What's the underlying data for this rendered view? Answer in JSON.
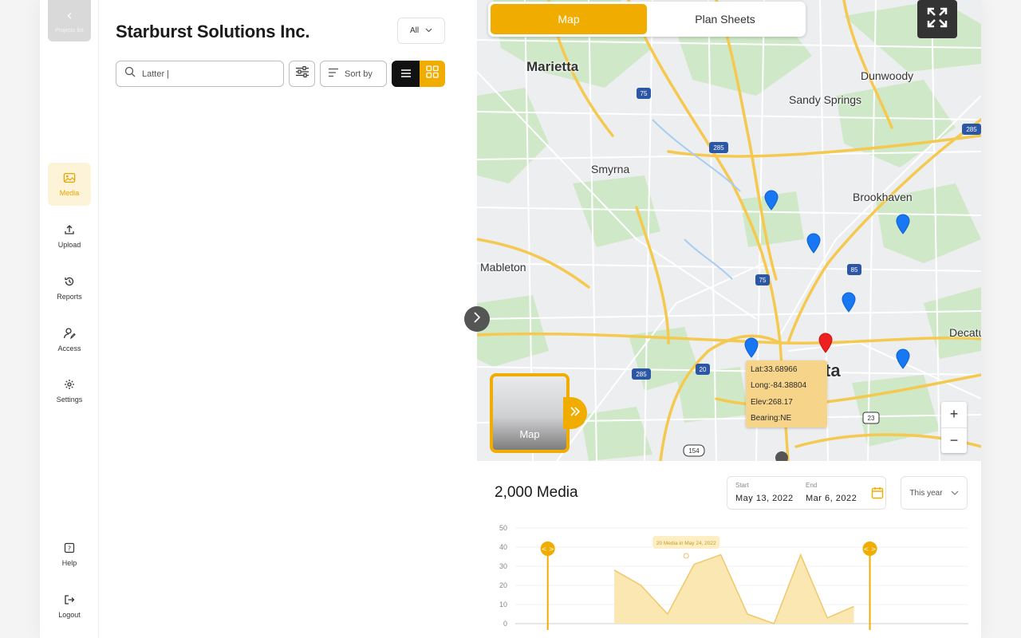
{
  "sidebar": {
    "back_label": "Projects list",
    "items": [
      {
        "label": "Media",
        "icon": "image-icon",
        "active": true
      },
      {
        "label": "Upload",
        "icon": "upload-icon"
      },
      {
        "label": "Reports",
        "icon": "history-icon"
      },
      {
        "label": "Access",
        "icon": "user-edit-icon"
      },
      {
        "label": "Settings",
        "icon": "gear-icon"
      }
    ],
    "bottom_items": [
      {
        "label": "Help",
        "icon": "help-icon"
      },
      {
        "label": "Logout",
        "icon": "logout-icon"
      }
    ]
  },
  "project": {
    "title": "Starburst Solutions Inc.",
    "filter_value": "All"
  },
  "search": {
    "value": "Latter |",
    "sort_label": "Sort by"
  },
  "map": {
    "tabs": [
      {
        "label": "Map",
        "active": true
      },
      {
        "label": "Plan Sheets",
        "active": false
      }
    ],
    "places": {
      "marietta": "Marietta",
      "dunwoody": "Dunwoody",
      "sandy_springs": "Sandy Springs",
      "smyrna": "Smyrna",
      "brookhaven": "Brookhaven",
      "mableton": "Mableton",
      "decatur": "Decatur",
      "atlanta_fragment": "ta"
    },
    "highways": {
      "h75a": "75",
      "h285a": "285",
      "h285b": "285",
      "h75b": "75",
      "h85": "85",
      "h20": "20",
      "h285c": "285",
      "h23": "23",
      "h154": "154"
    },
    "coord": {
      "lat": "Lat:33.68966",
      "long": "Long:-84.38804",
      "elev": "Elev:268.17",
      "bearing": "Bearing:NE"
    },
    "layer_label": "Map",
    "zoom_in": "+",
    "zoom_out": "−",
    "accent": "#f0ad00",
    "pin_color": "#1877f2",
    "selected_pin_color": "#ef2020"
  },
  "summary": {
    "count_label": "2,000 Media",
    "start_caption": "Start",
    "start_date": "May 13, 2022",
    "end_caption": "End",
    "end_date": "Mar 6, 2022",
    "period": "This year"
  },
  "chart_data": {
    "type": "area",
    "y_ticks": [
      "50",
      "40",
      "30",
      "20",
      "10",
      "0"
    ],
    "ylim": [
      0,
      50
    ],
    "x": [
      0,
      1,
      2,
      3,
      4,
      5,
      6,
      7,
      8,
      9,
      10,
      11,
      12,
      13,
      14,
      15,
      16
    ],
    "values": [
      null,
      null,
      null,
      28,
      20,
      5,
      31,
      36,
      5,
      0,
      36,
      3,
      9,
      null,
      null,
      null,
      null
    ],
    "tooltip": "20 Media in May 24, 2022",
    "handle_left_label": "< >",
    "handle_right_label": "< >",
    "color": "#f0ad00"
  }
}
